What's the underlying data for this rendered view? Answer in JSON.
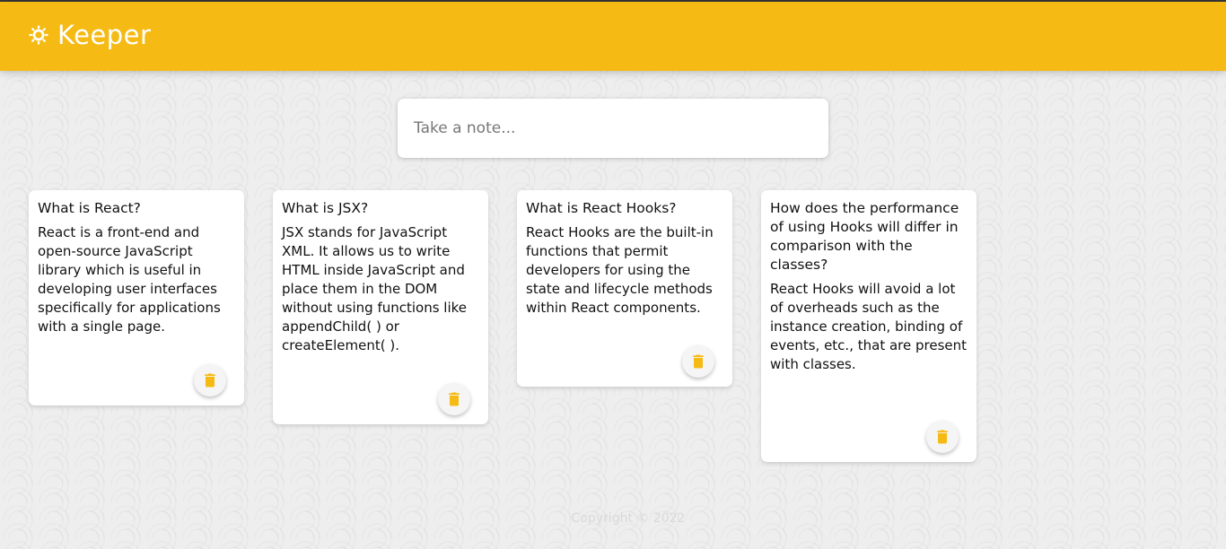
{
  "header": {
    "title": "Keeper",
    "logo_icon": "lightbulb-icon"
  },
  "create_note": {
    "placeholder": "Take a note..."
  },
  "notes": [
    {
      "title": "What is React?",
      "content": "React is a front-end and open-source JavaScript library which is useful in developing user interfaces specifically for applications with a single page."
    },
    {
      "title": "What is JSX?",
      "content": "JSX stands for JavaScript XML. It allows us to write HTML inside JavaScript and place them in the DOM without using functions like appendChild( ) or createElement( )."
    },
    {
      "title": "What is React Hooks?",
      "content": "React Hooks are the built-in functions that permit developers for using the state and lifecycle methods within React components."
    },
    {
      "title": "How does the performance of using Hooks will differ in comparison with the classes?",
      "content": "React Hooks will avoid a lot of overheads such as the instance creation, binding of events, etc., that are present with classes."
    }
  ],
  "footer": {
    "text": "Copyright © 2022"
  },
  "colors": {
    "accent": "#f5ba13",
    "background": "#eeeeee"
  }
}
